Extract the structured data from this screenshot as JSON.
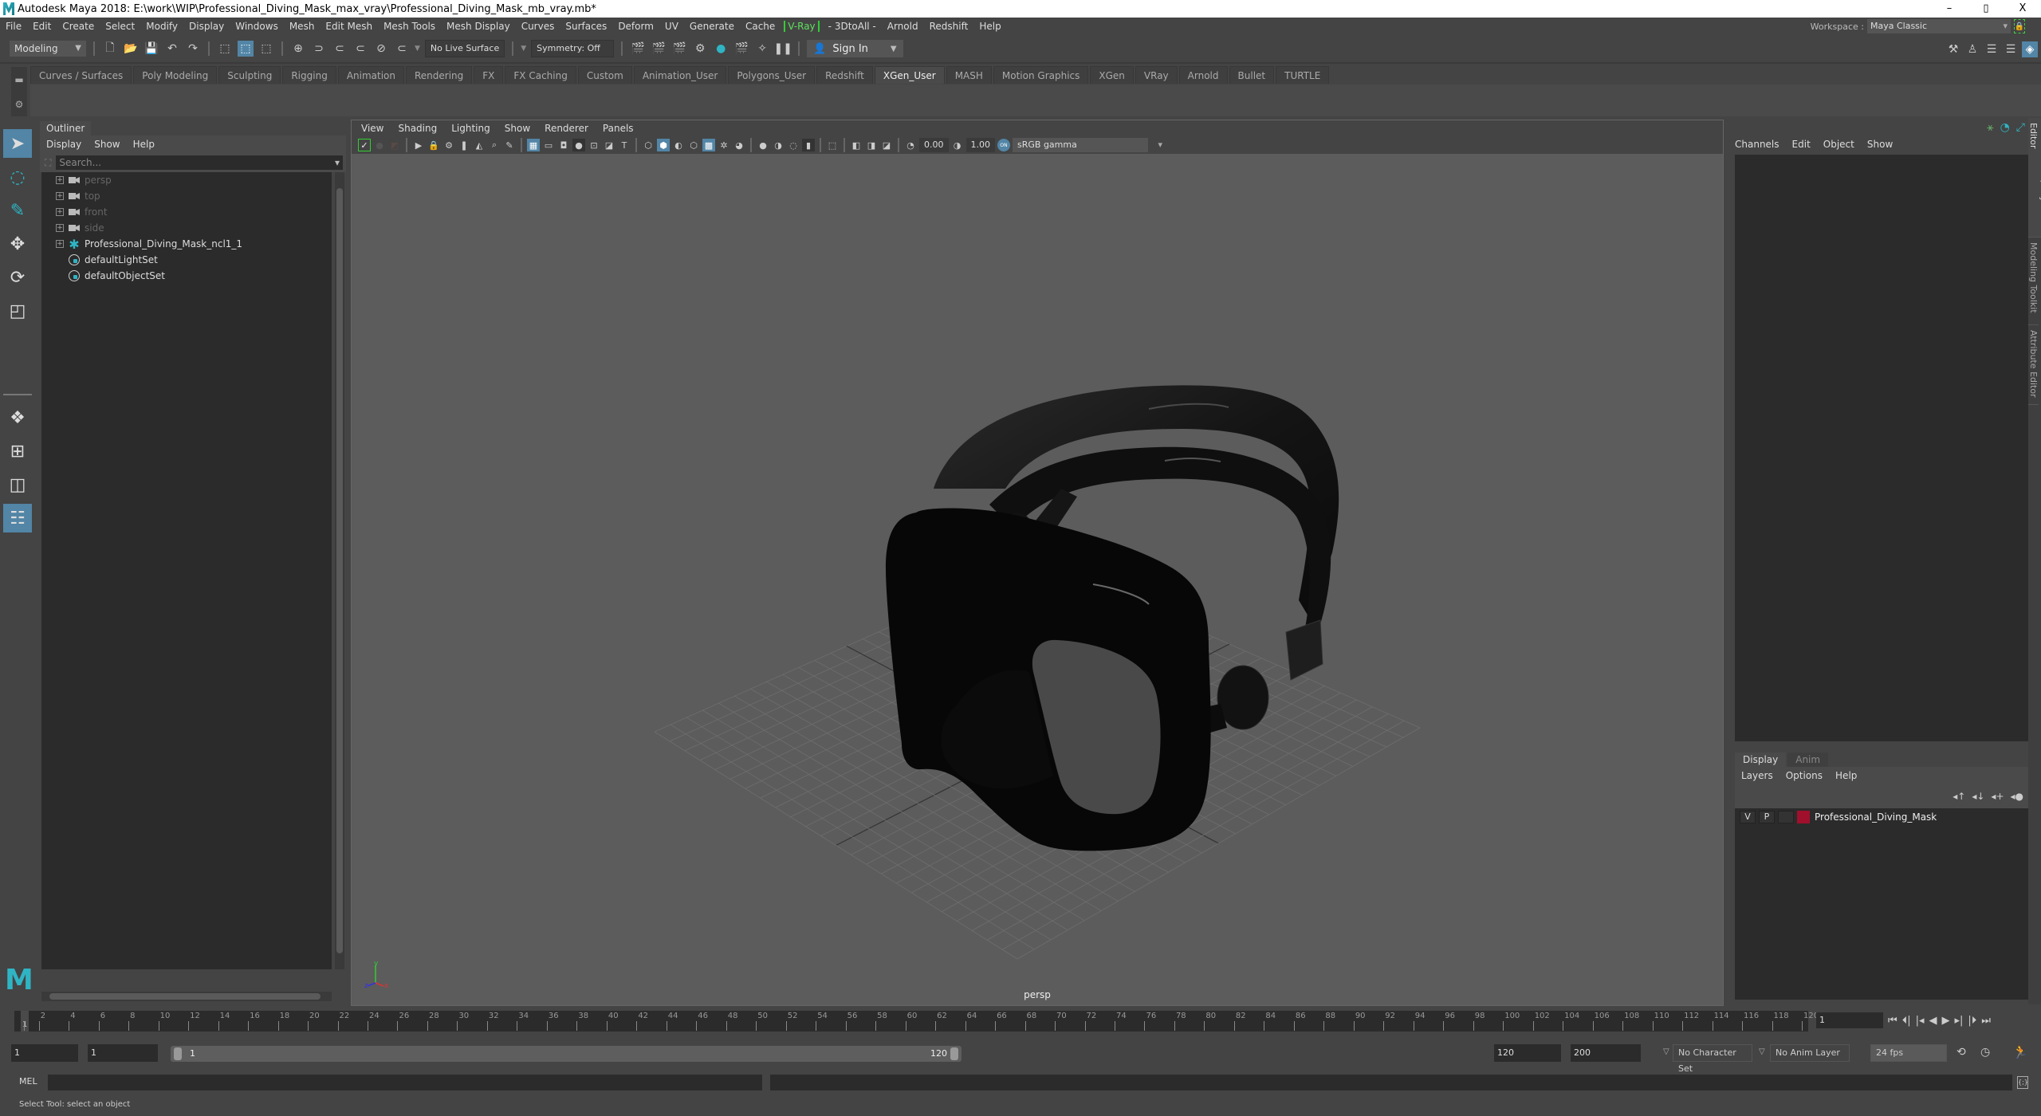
{
  "titlebar": {
    "title": "Autodesk Maya 2018: E:\\work\\WIP\\Professional_Diving_Mask_max_vray\\Professional_Diving_Mask_mb_vray.mb*",
    "minimize": "–",
    "maximize": "▯",
    "close": "X"
  },
  "menubar": {
    "items": [
      "File",
      "Edit",
      "Create",
      "Select",
      "Modify",
      "Display",
      "Windows",
      "Mesh",
      "Edit Mesh",
      "Mesh Tools",
      "Mesh Display",
      "Curves",
      "Surfaces",
      "Deform",
      "UV",
      "Generate",
      "Cache",
      "V-Ray",
      "- 3DtoAll -",
      "Arnold",
      "Redshift",
      "Help"
    ],
    "workspace_label": "Workspace :",
    "workspace_value": "Maya Classic"
  },
  "statusline": {
    "mode": "Modeling",
    "live_surface": "No Live Surface",
    "symmetry": "Symmetry: Off",
    "sign_in": "Sign In"
  },
  "shelf": {
    "tabs": [
      "Curves / Surfaces",
      "Poly Modeling",
      "Sculpting",
      "Rigging",
      "Animation",
      "Rendering",
      "FX",
      "FX Caching",
      "Custom",
      "Animation_User",
      "Polygons_User",
      "Redshift",
      "XGen_User",
      "MASH",
      "Motion Graphics",
      "XGen",
      "VRay",
      "Arnold",
      "Bullet",
      "TURTLE"
    ],
    "active_tab": "XGen_User"
  },
  "outliner": {
    "title": "Outliner",
    "menus": [
      "Display",
      "Show",
      "Help"
    ],
    "search_placeholder": "Search...",
    "items": [
      {
        "label": "persp",
        "type": "camera",
        "expandable": true
      },
      {
        "label": "top",
        "type": "camera",
        "expandable": true
      },
      {
        "label": "front",
        "type": "camera",
        "expandable": true
      },
      {
        "label": "side",
        "type": "camera",
        "expandable": true
      },
      {
        "label": "Professional_Diving_Mask_ncl1_1",
        "type": "group",
        "expandable": true
      },
      {
        "label": "defaultLightSet",
        "type": "set",
        "expandable": false
      },
      {
        "label": "defaultObjectSet",
        "type": "set",
        "expandable": false
      }
    ]
  },
  "viewport": {
    "menus": [
      "View",
      "Shading",
      "Lighting",
      "Show",
      "Renderer",
      "Panels"
    ],
    "exposure": "0.00",
    "gamma": "1.00",
    "color_space": "sRGB gamma",
    "camera_label": "persp",
    "axis": {
      "y": "y",
      "x": "x",
      "z": "z"
    }
  },
  "channelbox": {
    "menus": [
      "Channels",
      "Edit",
      "Object",
      "Show"
    ]
  },
  "layereditor": {
    "tabs": [
      "Display",
      "Anim"
    ],
    "active_tab": "Display",
    "menus": [
      "Layers",
      "Options",
      "Help"
    ],
    "layers": [
      {
        "visible": "V",
        "playback": "P",
        "name": "Professional_Diving_Mask",
        "color": "#a0102c"
      }
    ]
  },
  "sidetabs": [
    "Channel Box / Layer Editor",
    "Modeling Toolkit",
    "Attribute Editor"
  ],
  "timeslider": {
    "start": 1,
    "end": 120,
    "step": 2,
    "current_frame": "1",
    "current_frame_field": "1"
  },
  "rangeslider": {
    "start_field": "1",
    "anim_start_field": "1",
    "range_start": "1",
    "range_end": "120",
    "end_field": "120",
    "anim_end_field": "200",
    "character_set": "No Character Set",
    "anim_layer": "No Anim Layer",
    "fps": "24 fps"
  },
  "cmdline": {
    "label": "MEL"
  },
  "helpline": {
    "text": "Select Tool: select an object"
  }
}
